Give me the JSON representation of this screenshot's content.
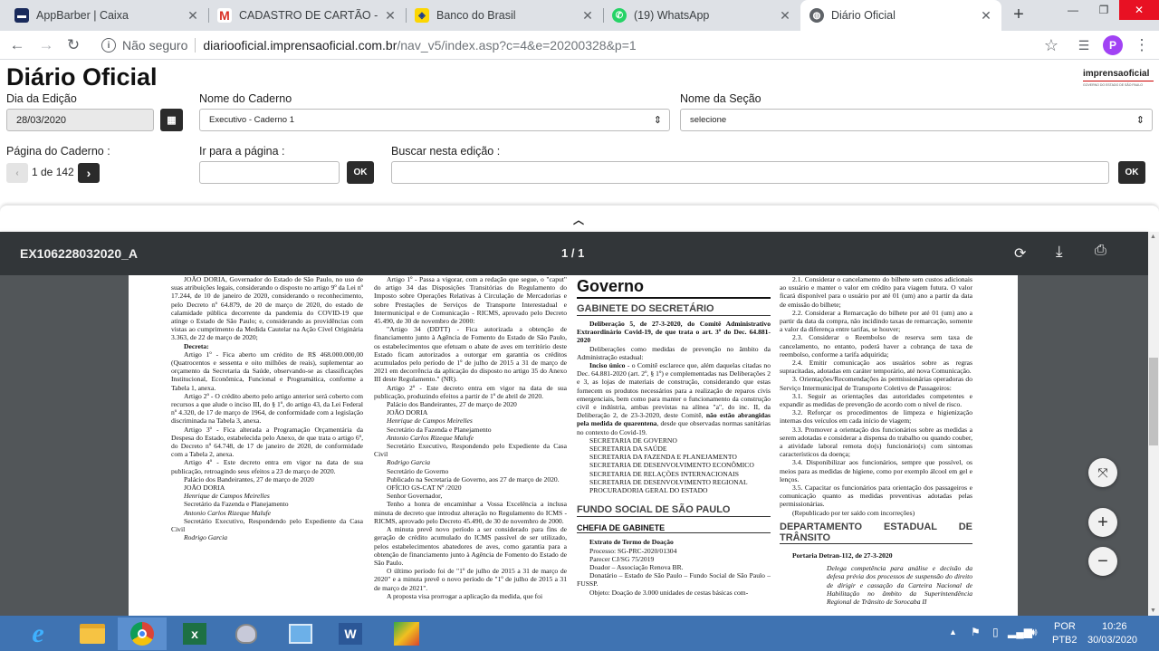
{
  "browser": {
    "tabs": [
      {
        "title": "AppBarber | Caixa",
        "icon": "appbarber-icon",
        "active": false
      },
      {
        "title": "CADASTRO DE CARTÃO - jurídi",
        "icon": "gmail-icon",
        "active": false
      },
      {
        "title": "Banco do Brasil",
        "icon": "banco-do-brasil-icon",
        "active": false
      },
      {
        "title": "(19) WhatsApp",
        "icon": "whatsapp-icon",
        "active": false
      },
      {
        "title": "Diário Oficial",
        "icon": "globe-icon",
        "active": true
      }
    ],
    "security_label": "Não seguro",
    "url_host": "diariooficial.imprensaoficial.com.br",
    "url_path": "/nav_v5/index.asp?c=4&e=20200328&p=1",
    "profile_initial": "P",
    "colors": {
      "tabstrip": "#dee1e6",
      "close": "#e81123",
      "profile": "#a142f4"
    }
  },
  "header": {
    "title": "Diário Oficial",
    "brand_main": "imprensaoficial",
    "brand_sub": "GOVERNO DO ESTADO DE SÃO PAULO"
  },
  "filters": {
    "date_label": "Dia da Edição",
    "date_value": "28/03/2020",
    "caderno_label": "Nome do Caderno",
    "caderno_value": "Executivo - Caderno 1",
    "secao_label": "Nome da Seção",
    "secao_value": "selecione",
    "page_label": "Página do Caderno :",
    "page_indicator": "1 de 142",
    "goto_label": "Ir para a página :",
    "goto_button": "OK",
    "search_label": "Buscar nesta edição :",
    "search_button": "OK"
  },
  "pdf": {
    "filename": "EX106228032020_A",
    "page_indicator": "1 / 1"
  },
  "doc": {
    "c1": [
      "JOÃO DORIA, Governador do Estado de São Paulo, no uso de suas atribuições legais, considerando o disposto no artigo 9º da Lei nº 17.244, de 10 de janeiro de 2020, considerando o reconhecimento, pelo Decreto nº 64.879, de 20 de março de 2020, do estado de calamidade pública decorrente da pandemia do COVID-19 que atinge o Estado de São Paulo; e, considerando as providências com vistas ao cumprimento da Medida Cautelar na Ação Cível Originária 3.363, de 22 de março de 2020;",
      "Decreta:",
      "Artigo 1º - Fica aberto um crédito de R$ 468.000.000,00 (Quatrocentos e sessenta e oito milhões de reais), suplementar ao orçamento da Secretaria da Saúde, observando-se as classificações Institucional, Econômica, Funcional e Programática, conforme a Tabela 1, anexa.",
      "Artigo 2º - O crédito aberto pelo artigo anterior será coberto com recursos a que alude o inciso III, do § 1º, do artigo 43, da Lei Federal nº 4.320, de 17 de março de 1964, de conformidade com a legislação discriminada na Tabela 3, anexa.",
      "Artigo 3º - Fica alterada a Programação Orçamentária da Despesa do Estado, estabelecida pelo Anexo, de que trata o artigo 6º, do Decreto nº 64.748, de 17 de janeiro de 2020, de conformidade com a Tabela 2, anexa.",
      "Artigo 4º - Este decreto entra em vigor na data de sua publicação, retroagindo seus efeitos a 23 de março de 2020.",
      "Palácio dos Bandeirantes, 27 de março de 2020",
      "JOÃO DORIA",
      "Henrique de Campos Meirelles",
      "Secretário da Fazenda e Planejamento",
      "Antonio Carlos Rizeque Malufe",
      "Secretário Executivo, Respondendo pelo Expediente da Casa Civil",
      "Rodrigo Garcia"
    ],
    "c2": [
      "Artigo 1º - Passa a vigorar, com a redação que segue, o \"caput\" do artigo 34 das Disposições Transitórias do Regulamento do Imposto sobre Operações Relativas à Circulação de Mercadorias e sobre Prestações de Serviços de Transporte Interestadual e Intermunicipal e de Comunicação - RICMS, aprovado pelo Decreto 45.490, de 30 de novembro de 2000:",
      "\"Artigo 34 (DDTT) - Fica autorizada a obtenção de financiamento junto à Agência de Fomento do Estado de São Paulo, os estabelecimentos que efetuam o abate de aves em território deste Estado ficam autorizados a outorgar em garantia os créditos acumulados pelo período de 1º de julho de 2015 a 31 de março de 2021 em decorrência da aplicação do disposto no artigo 35 do Anexo III deste Regulamento.\" (NR).",
      "Artigo 2º - Este decreto entra em vigor na data de sua publicação, produzindo efeitos a partir de 1º de abril de 2020.",
      "Palácio dos Bandeirantes, 27 de março de 2020",
      "JOÃO DORIA",
      "Henrique de Campos Meirelles",
      "Secretário da Fazenda e Planejamento",
      "Antonio Carlos Rizeque Malufe",
      "Secretário Executivo, Respondendo pelo Expediente da Casa Civil",
      "Rodrigo Garcia",
      "Secretário de Governo",
      "Publicado na Secretaria de Governo, aos 27 de março de 2020.",
      "OFÍCIO GS-CAT Nº /2020",
      "Senhor Governador,",
      "Tenho a honra de encaminhar a Vossa Excelência a inclusa minuta de decreto que introduz alteração no Regulamento do ICMS - RICMS, aprovado pelo Decreto 45.490, de 30 de novembro de 2000.",
      "A minuta prevê novo período a ser considerado para fins de geração de crédito acumulado do ICMS passível de ser utilizado, pelos estabelecimentos abatedores de aves, como garantia para a obtenção de financiamento junto à Agência de Fomento do Estado de São Paulo.",
      "O último período foi de \"1º de julho de 2015 a 31 de março de 2020\" e a minuta prevê o novo período de \"1º de julho de 2015 a 31 de março de 2021\".",
      "A proposta visa prorrogar a aplicação da medida, que foi"
    ],
    "c3": {
      "heading": "Governo",
      "section1": "GABINETE DO SECRETÁRIO",
      "delib_title": "Deliberação 5, de 27-3-2020, do Comitê Administrativo Extraordinário Covid-19, de que trata o art. 3º do Dec. 64.881-2020",
      "delib_sub": "Deliberações como medidas de prevenção no âmbito da Administração estadual:",
      "delib_lead": "Inciso único",
      "delib_body": " - o Comitê esclarece que, além daquelas citadas no Dec. 64.881-2020 (art. 2º, § 1º) e complementadas nas Deliberações 2 e 3, as lojas de materiais de construção, considerando que estas fornecem os produtos necessários para a realização de reparos civis emergenciais, bem como para manter o funcionamento da construção civil e indústria, ambas previstas na alínea \"a\", do inc. II, da Deliberação 2, de 23-3-2020, deste Comitê, ",
      "delib_bold": "não estão abrangidas pela medida de quarentena",
      "delib_end": ", desde que observadas normas sanitárias no contexto do Covid-19.",
      "secretarias": [
        "SECRETARIA DE GOVERNO",
        "SECRETARIA DA SAÚDE",
        "SECRETARIA DA FAZENDA E PLANEJAMENTO",
        "SECRETARIA DE DESENVOLVIMENTO ECONÔMICO",
        "SECRETARIA DE RELAÇÕES INTERNACIONAIS",
        "SECRETARIA DE DESENVOLVIMENTO REGIONAL",
        "PROCURADORIA GERAL DO ESTADO"
      ],
      "section2": "FUNDO SOCIAL DE SÃO PAULO",
      "section3": "CHEFIA DE GABINETE",
      "extrato_title": "Extrato de Termo de Doação",
      "extrato": [
        "Processo: SG-PRC-2020/01304",
        "Parecer CJ/SG 75/2019",
        "Doador – Associação Renova BR.",
        "Donatário – Estado de São Paulo – Fundo Social de São Paulo – FUSSP.",
        "Objeto: Doação de 3.000 unidades de cestas básicas com-"
      ]
    },
    "c4": {
      "items": [
        "2.1. Considerar o cancelamento do bilhete sem custos adicionais ao usuário e manter o valor em crédito para viagem futura. O valor ficará disponível para o usuário por até 01 (um) ano a partir da data de emissão do bilhete;",
        "2.2. Considerar a Remarcação do bilhete por até 01 (um) ano a partir da data da compra, não incidindo taxas de remarcação, somente a valor da diferença entre tarifas, se houver;",
        "2.3. Considerar o Reembolso de reserva sem taxa de cancelamento, no entanto, poderá haver a cobrança de taxa de reembolso, conforme a tarifa adquirida;",
        "2.4. Emitir comunicação aos usuários sobre as regras supracitadas, adotadas em caráter temporário, até nova Comunicação.",
        "3. Orientações/Recomendações às permissionárias operadoras do Serviço Intermunicipal de Transporte Coletivo de Passageiros:",
        "3.1. Seguir as orientações das autoridades competentes e expandir as medidas de prevenção de acordo com o nível de risco.",
        "3.2. Reforçar os procedimentos de limpeza e higienização internas dos veículos em cada início de viagem;",
        "3.3. Promover a orientação dos funcionários sobre as medidas a serem adotadas e considerar a dispensa do trabalho ou quando couber, a atividade laboral remota do(s) funcionário(s) com sintomas característicos da doença;",
        "3.4. Disponibilizar aos funcionários, sempre que possível, os meios para as medidas de higiene, como por exemplo álcool em gel e lenços.",
        "3.5. Capacitar os funcionários para orientação dos passageiros e comunicação quanto as medidas preventivas adotadas pelas permissionárias.",
        "(Republicado por ter saído com incorreções)"
      ],
      "section": "DEPARTAMENTO ESTADUAL DE TRÂNSITO",
      "portaria": "Portaria Detran-112, de 27-3-2020",
      "delega": "Delega competência para análise e decisão da defesa prévia dos processos de suspensão do direito de dirigir e cassação da Carteira Nacional de Habilitação no âmbito da Superintendência Regional de Trânsito de Sorocaba II"
    }
  },
  "taskbar": {
    "apps": [
      "ie-icon",
      "explorer-icon",
      "chrome-icon",
      "excel-icon",
      "paint-icon",
      "control-panel-icon",
      "word-icon",
      "app-icon"
    ],
    "lang": "POR",
    "lang_sub": "PTB2",
    "time": "10:26",
    "date": "30/03/2020",
    "colors": {
      "bar": "#3f73b2"
    }
  }
}
